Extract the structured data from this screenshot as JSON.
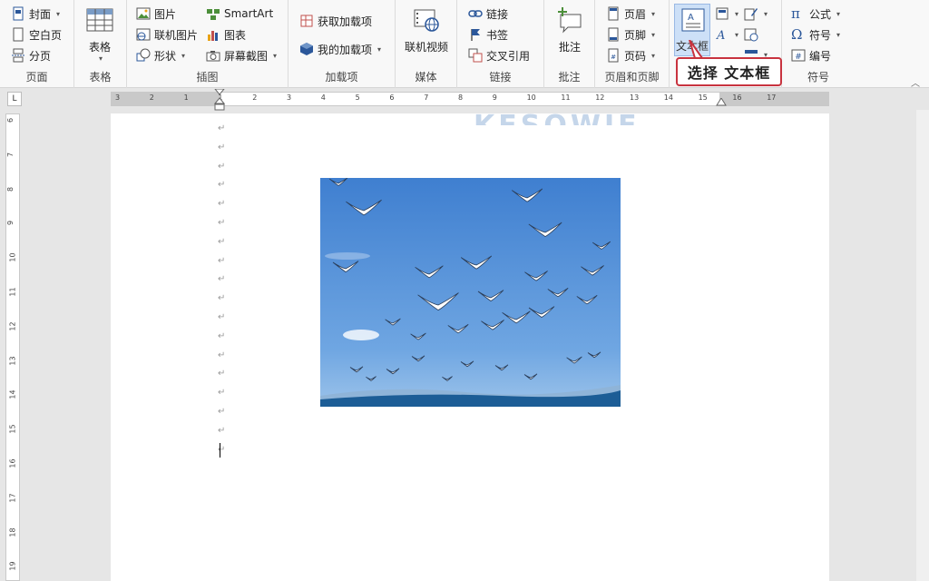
{
  "ribbon": {
    "page_group": {
      "label": "页面",
      "cover": "封面",
      "blank": "空白页",
      "break": "分页"
    },
    "table_group": {
      "label": "表格",
      "table": "表格"
    },
    "illus_group": {
      "label": "插图",
      "picture": "图片",
      "online_picture": "联机图片",
      "shapes": "形状",
      "smartart": "SmartArt",
      "chart": "图表",
      "screenshot": "屏幕截图"
    },
    "addins_group": {
      "label": "加载项",
      "get": "获取加载项",
      "my": "我的加载项"
    },
    "media_group": {
      "label": "媒体",
      "online_video": "联机视频"
    },
    "links_group": {
      "label": "链接",
      "link": "链接",
      "bookmark": "书签",
      "cross_ref": "交叉引用"
    },
    "comment_group": {
      "label": "批注",
      "comment": "批注"
    },
    "hf_group": {
      "label": "页眉和页脚",
      "header": "页眉",
      "footer": "页脚",
      "page_num": "页码"
    },
    "text_group": {
      "textbox": "文本框"
    },
    "symbols_group": {
      "label": "符号",
      "equation": "公式",
      "symbol": "符号",
      "number": "编号"
    }
  },
  "callout": {
    "text": "选择 文本框"
  },
  "watermark": {
    "text": "KESOWIE"
  },
  "ruler": {
    "ticks": [
      "3",
      "2",
      "1",
      "1",
      "2",
      "3",
      "4",
      "5",
      "6",
      "7",
      "8",
      "9",
      "10",
      "11",
      "12",
      "13",
      "14",
      "15",
      "16",
      "17"
    ]
  },
  "vruler": {
    "ticks": [
      "6",
      "7",
      "8",
      "9",
      "10",
      "11",
      "12",
      "13",
      "14",
      "15",
      "16",
      "17",
      "18",
      "19"
    ]
  },
  "colors": {
    "accent": "#2b579a",
    "callout_border": "#c8333f",
    "sky_top": "#3f7fd0",
    "sea": "#1c5d96"
  }
}
